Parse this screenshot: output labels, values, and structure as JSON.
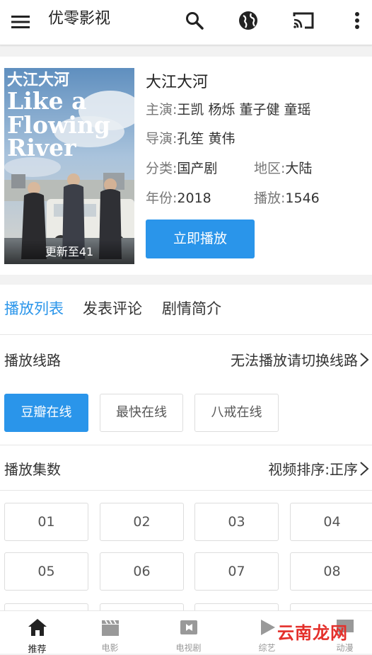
{
  "header": {
    "title": "优零影视"
  },
  "detail": {
    "poster_title_cn": "大江大河",
    "poster_title_en_1": "Like a",
    "poster_title_en_2": "Flowing",
    "poster_title_en_3": "River",
    "poster_episode_badge": "更新至41",
    "name": "大江大河",
    "cast_label": "主演:",
    "cast": "王凯 杨烁 董子健 童瑶",
    "director_label": "导演:",
    "director": "孔笙 黄伟",
    "category_label": "分类:",
    "category": "国产剧",
    "region_label": "地区:",
    "region": "大陆",
    "year_label": "年份:",
    "year": "2018",
    "plays_label": "播放:",
    "plays": "1546",
    "play_button": "立即播放"
  },
  "tabs": [
    "播放列表",
    "发表评论",
    "剧情简介"
  ],
  "play_source": {
    "title": "播放线路",
    "hint": "无法播放请切换线路",
    "options": [
      "豆瓣在线",
      "最快在线",
      "八戒在线"
    ]
  },
  "episodes_section": {
    "title": "播放集数",
    "sort_label": "视频排序:",
    "sort_value": "正序",
    "episodes": [
      "01",
      "02",
      "03",
      "04",
      "05",
      "06",
      "07",
      "08"
    ]
  },
  "bottom_nav": [
    "推荐",
    "电影",
    "电视剧",
    "综艺",
    "动漫"
  ],
  "watermark": "云南龙网",
  "colors": {
    "accent": "#2a95ea",
    "watermark": "#e4302b"
  }
}
